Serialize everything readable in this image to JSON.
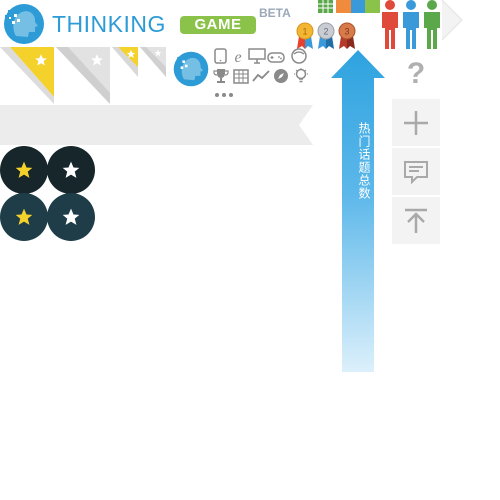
{
  "header": {
    "logo_word_1": "THINKING",
    "logo_word_2": "GAME",
    "beta_label": "BETA"
  },
  "arrow": {
    "label": "热门话题总数"
  },
  "sidebar": {
    "help_label": "?",
    "add_label": "+"
  },
  "colors": {
    "brand_blue": "#2c9bd6",
    "brand_green": "#8bc34a",
    "star_gold": "#f5d12c",
    "dark_circle": "#16262a",
    "teal_circle": "#1f3d48",
    "banner_gray": "#ececec",
    "person_red": "#e04a3a",
    "person_blue": "#3a9ad9",
    "person_green": "#5aa84a"
  },
  "icons": {
    "medals": [
      "gold-medal-icon",
      "silver-medal-icon",
      "bronze-medal-icon"
    ],
    "people": [
      "red-person-icon",
      "blue-person-icon",
      "green-person-icon"
    ],
    "grid": [
      "tablet-icon",
      "ie-browser-icon",
      "monitor-icon",
      "gamepad-icon",
      "face-icon",
      "trophy-icon",
      "building-icon",
      "trend-chart-icon",
      "compass-icon",
      "lightbulb-icon",
      "more-dots-icon"
    ]
  }
}
